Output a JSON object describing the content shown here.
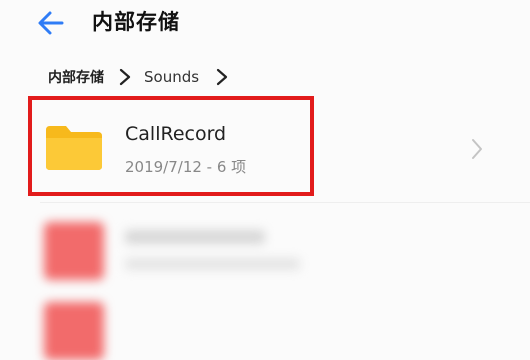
{
  "header": {
    "title": "内部存储",
    "back_icon": "back-arrow-icon",
    "accent_color": "#2f7cf6"
  },
  "breadcrumb": {
    "root": "内部存储",
    "current": "Sounds",
    "separator_icon": "chevron-right-icon"
  },
  "list": {
    "items": [
      {
        "name": "CallRecord",
        "meta": "2019/7/12 - 6 项",
        "icon": "folder-icon",
        "icon_color": "#f9c12e",
        "highlighted": true,
        "highlight_color": "#e21b1b"
      }
    ],
    "chevron_icon": "chevron-right-icon"
  }
}
